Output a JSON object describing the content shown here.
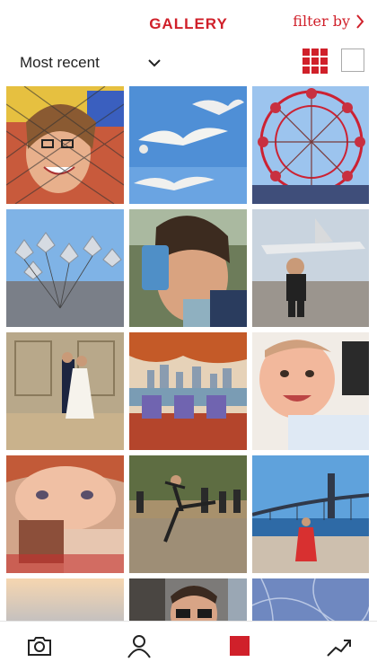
{
  "header": {
    "title": "GALLERY",
    "filter_label": "filter by",
    "accent_color": "#d0202a"
  },
  "toolbar": {
    "sort_label": "Most recent",
    "view_modes": [
      "grid-view-icon",
      "single-view-icon"
    ],
    "active_view": "grid"
  },
  "gallery": {
    "photos": [
      {
        "name": "girl-behind-net"
      },
      {
        "name": "seagulls-in-sky"
      },
      {
        "name": "ferris-wheel"
      },
      {
        "name": "silver-balloons"
      },
      {
        "name": "woman-with-phone"
      },
      {
        "name": "boy-at-aircraft-museum"
      },
      {
        "name": "wedding-couple"
      },
      {
        "name": "city-skyline-chairs"
      },
      {
        "name": "smiling-baby"
      },
      {
        "name": "redhead-child"
      },
      {
        "name": "dancer-in-park"
      },
      {
        "name": "woman-by-bridge"
      },
      {
        "name": "sunset-sky"
      },
      {
        "name": "man-with-sunglasses"
      },
      {
        "name": "blue-tree"
      }
    ]
  },
  "tabbar": {
    "tabs": [
      "camera-icon",
      "profile-icon",
      "gallery-icon",
      "trending-icon"
    ],
    "active_tab": "gallery-icon"
  }
}
